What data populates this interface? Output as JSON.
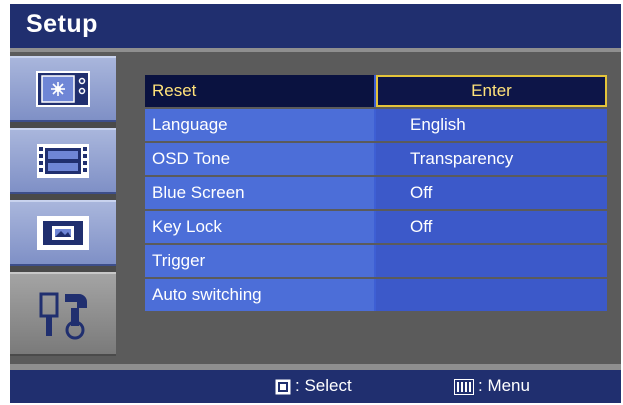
{
  "window": {
    "title": "Setup"
  },
  "sidebar": {
    "items": [
      {
        "name": "picture",
        "icon": "monitor-brightness-icon",
        "active": false
      },
      {
        "name": "layout",
        "icon": "film-strip-icon",
        "active": false
      },
      {
        "name": "display",
        "icon": "screen-image-icon",
        "active": false
      },
      {
        "name": "setup",
        "icon": "tools-icon",
        "active": true
      }
    ]
  },
  "menu": {
    "rows": [
      {
        "label": "Reset",
        "value": "Enter",
        "selected": true
      },
      {
        "label": "Language",
        "value": "English"
      },
      {
        "label": "OSD Tone",
        "value": "Transparency"
      },
      {
        "label": "Blue Screen",
        "value": "Off"
      },
      {
        "label": "Key Lock",
        "value": "Off"
      },
      {
        "label": "Trigger",
        "value": ""
      },
      {
        "label": "Auto switching",
        "value": ""
      }
    ]
  },
  "footer": {
    "select_hint": ": Select",
    "menu_hint": ": Menu",
    "select_icon": "square-button-icon",
    "menu_icon": "menu-button-icon"
  },
  "colors": {
    "title_bar": "#202f6f",
    "label_cell": "#4c6ed8",
    "value_cell": "#3c59c9",
    "selected_text": "#ffe27a",
    "selected_border": "#e4c43a"
  }
}
